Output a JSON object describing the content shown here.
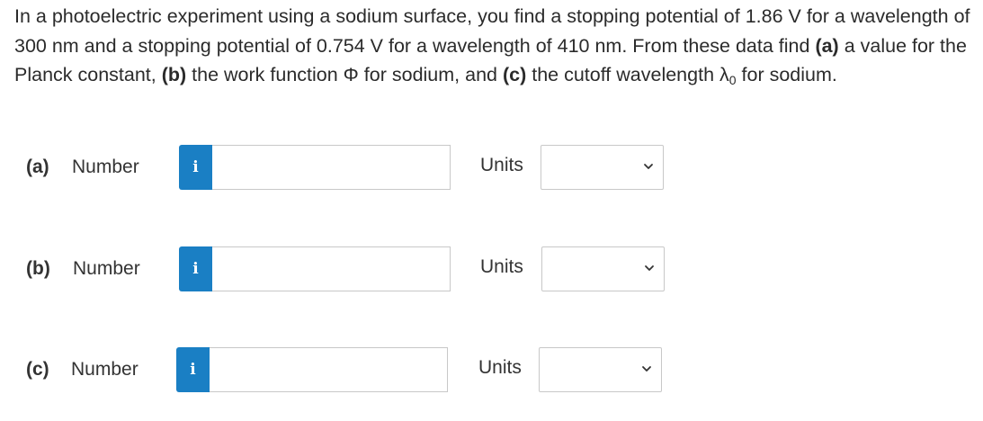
{
  "question": {
    "text_1": "In a photoelectric experiment using a sodium surface, you find a stopping potential of 1.86 V for a wavelength of 300 nm and a stopping potential of 0.754 V for a wavelength of 410 nm. From these data find ",
    "a_marker": "(a)",
    "text_2": " a value for the Planck constant, ",
    "b_marker": "(b)",
    "text_3": " the work function Φ for sodium, and ",
    "c_marker": "(c)",
    "text_4": " the cutoff wavelength λ",
    "subscript": "0",
    "text_5": " for sodium."
  },
  "parts": [
    {
      "label": "(a)",
      "number_label": "Number",
      "info_icon": "i",
      "number_value": "",
      "units_label": "Units",
      "units_value": ""
    },
    {
      "label": "(b)",
      "number_label": "Number",
      "info_icon": "i",
      "number_value": "",
      "units_label": "Units",
      "units_value": ""
    },
    {
      "label": "(c)",
      "number_label": "Number",
      "info_icon": "i",
      "number_value": "",
      "units_label": "Units",
      "units_value": ""
    }
  ],
  "colors": {
    "info_button": "#1a7fc4",
    "text": "#2b2b2b",
    "border": "#c8c8c8"
  }
}
